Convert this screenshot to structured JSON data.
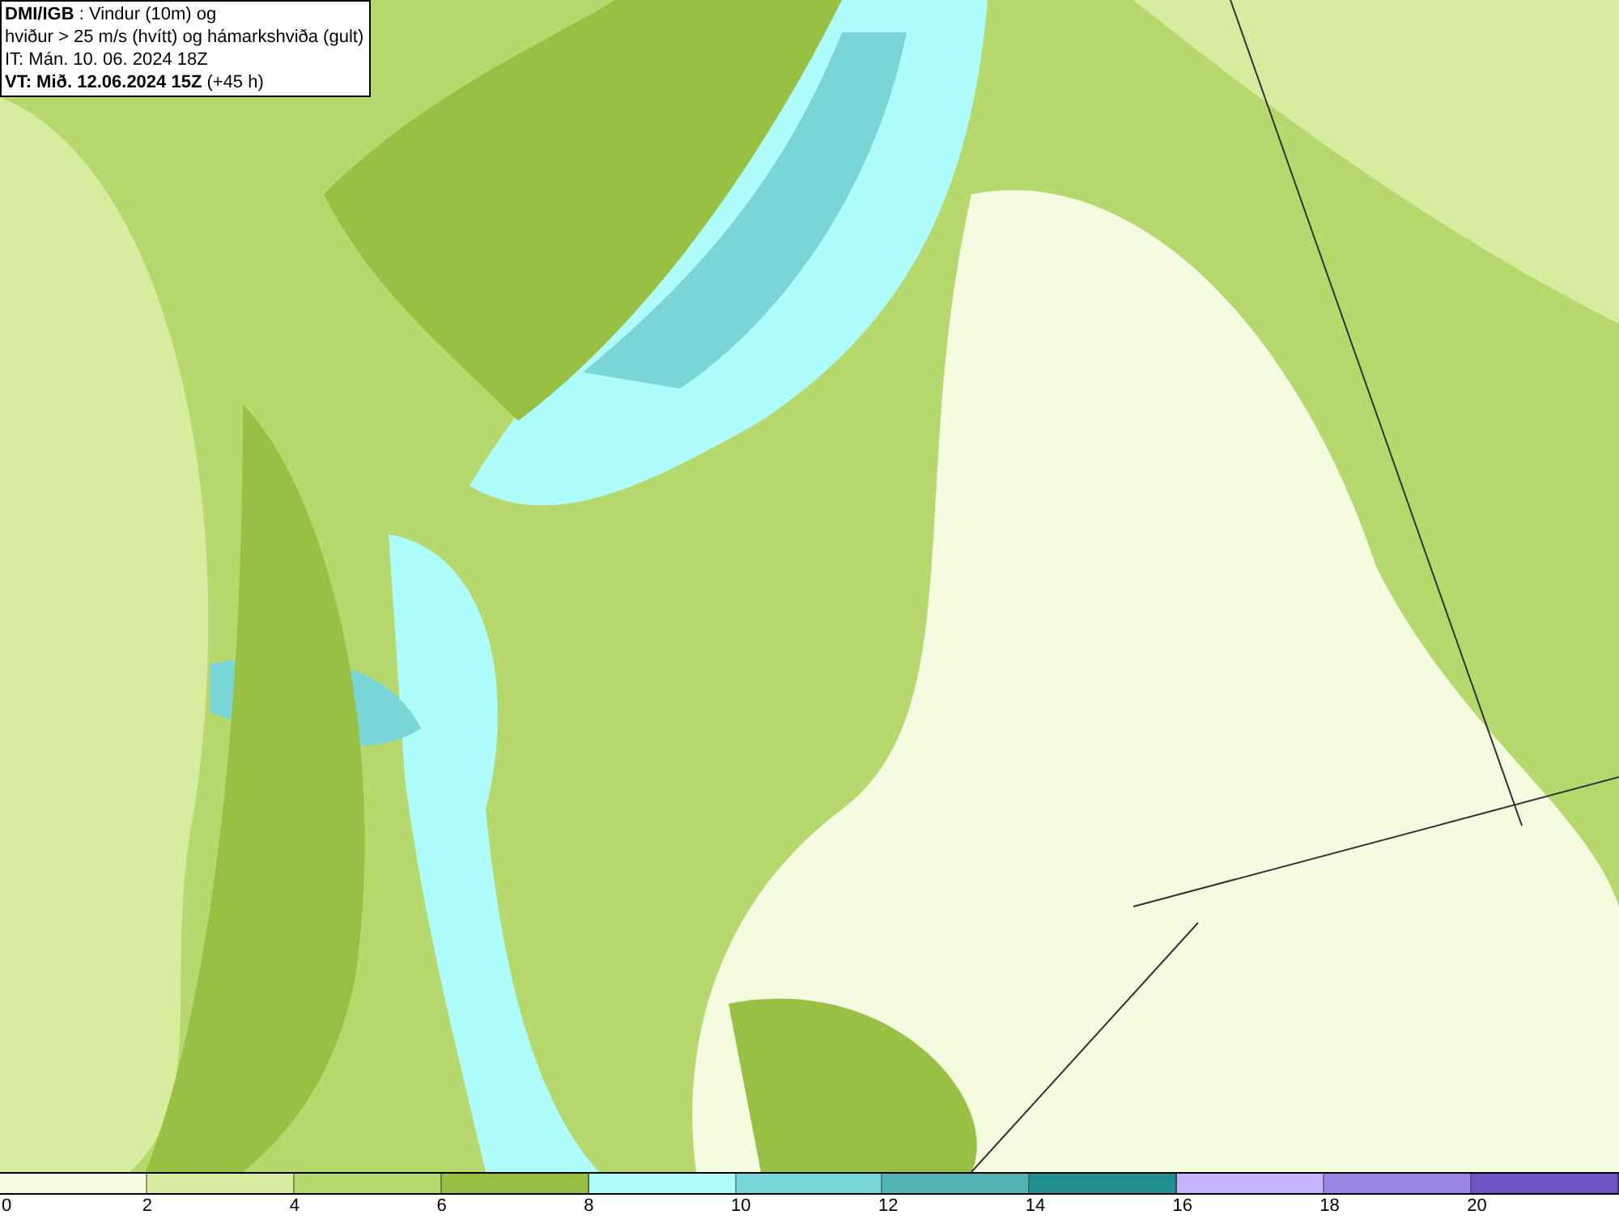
{
  "header": {
    "lines": [
      "**DMI/IGB** : Vindur (10m) og",
      "hviður > 25 m/s (hvítt) og hámarkshviða (gult)",
      "IT: Mán. 10. 06. 2024 18Z",
      "**VT: Mið. 12.06.2024 15Z** (+45 h)"
    ]
  },
  "legend": {
    "bins": [
      {
        "color": "#f4fbe0"
      },
      {
        "color": "#d6eda0"
      },
      {
        "color": "#b6d96e"
      },
      {
        "color": "#98c042"
      },
      {
        "color": "#aefcfc"
      },
      {
        "color": "#7ad6d6"
      },
      {
        "color": "#52b2b4"
      },
      {
        "color": "#229090"
      },
      {
        "color": "#c4b4fc"
      },
      {
        "color": "#9a86e0"
      },
      {
        "color": "#6e54c4"
      }
    ],
    "labels": [
      "0",
      "2",
      "4",
      "6",
      "8",
      "10",
      "12",
      "14",
      "16",
      "18",
      "20"
    ]
  }
}
